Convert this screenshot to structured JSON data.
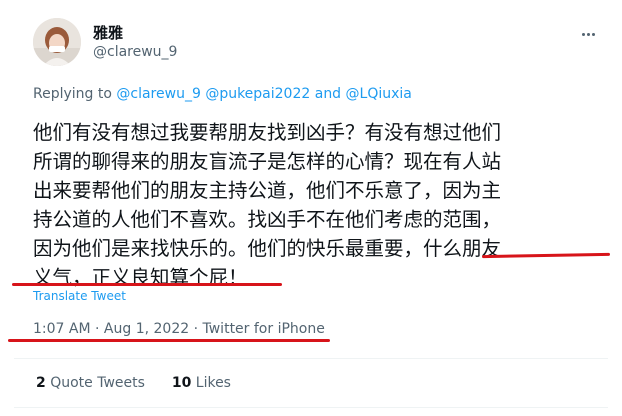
{
  "tweet": {
    "author_name": "雅雅",
    "author_handle": "@clarewu_9",
    "replying_prefix": "Replying to",
    "replying_mentions": [
      "@clarewu_9",
      "@pukepai2022"
    ],
    "replying_and": "and",
    "replying_last": "@LQiuxia",
    "text": "他们有没有想过我要帮朋友找到凶手？有没有想过他们\n所谓的聊得来的朋友盲流子是怎样的心情？现在有人站\n出来要帮他们的朋友主持公道，他们不乐意了，因为主\n持公道的人他们不喜欢。找凶手不在他们考虑的范围，\n因为他们是来找快乐的。他们的快乐最重要，什么朋友\n义气，正义良知算个屁！",
    "translate_label": "Translate Tweet",
    "time": "1:07 AM",
    "date": "Aug 1, 2022",
    "source": "Twitter for iPhone",
    "separator": "·"
  },
  "stats": {
    "quote_count": "2",
    "quote_label": "Quote Tweets",
    "likes_count": "10",
    "likes_label": "Likes"
  },
  "icons": {
    "more": "more-horizontal-icon"
  },
  "colors": {
    "accent": "#1d9bf0",
    "annotation": "#d7141a",
    "muted": "#536471",
    "text": "#0f1419"
  }
}
